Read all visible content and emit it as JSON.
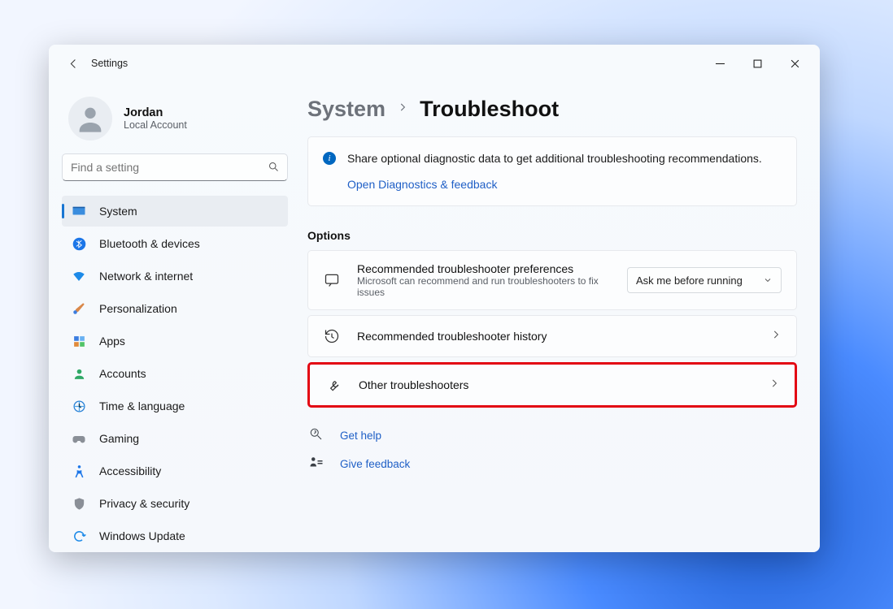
{
  "app": {
    "title": "Settings"
  },
  "user": {
    "name": "Jordan",
    "accountType": "Local Account"
  },
  "search": {
    "placeholder": "Find a setting"
  },
  "sidebar": {
    "items": [
      {
        "label": "System"
      },
      {
        "label": "Bluetooth & devices"
      },
      {
        "label": "Network & internet"
      },
      {
        "label": "Personalization"
      },
      {
        "label": "Apps"
      },
      {
        "label": "Accounts"
      },
      {
        "label": "Time & language"
      },
      {
        "label": "Gaming"
      },
      {
        "label": "Accessibility"
      },
      {
        "label": "Privacy & security"
      },
      {
        "label": "Windows Update"
      }
    ]
  },
  "breadcrumb": {
    "parent": "System",
    "current": "Troubleshoot"
  },
  "infoCard": {
    "text": "Share optional diagnostic data to get additional troubleshooting recommendations.",
    "link": "Open Diagnostics & feedback"
  },
  "sectionTitle": "Options",
  "options": {
    "prefs": {
      "title": "Recommended troubleshooter preferences",
      "subtitle": "Microsoft can recommend and run troubleshooters to fix issues",
      "dropdownValue": "Ask me before running"
    },
    "history": {
      "title": "Recommended troubleshooter history"
    },
    "other": {
      "title": "Other troubleshooters"
    }
  },
  "footer": {
    "help": "Get help",
    "feedback": "Give feedback"
  }
}
